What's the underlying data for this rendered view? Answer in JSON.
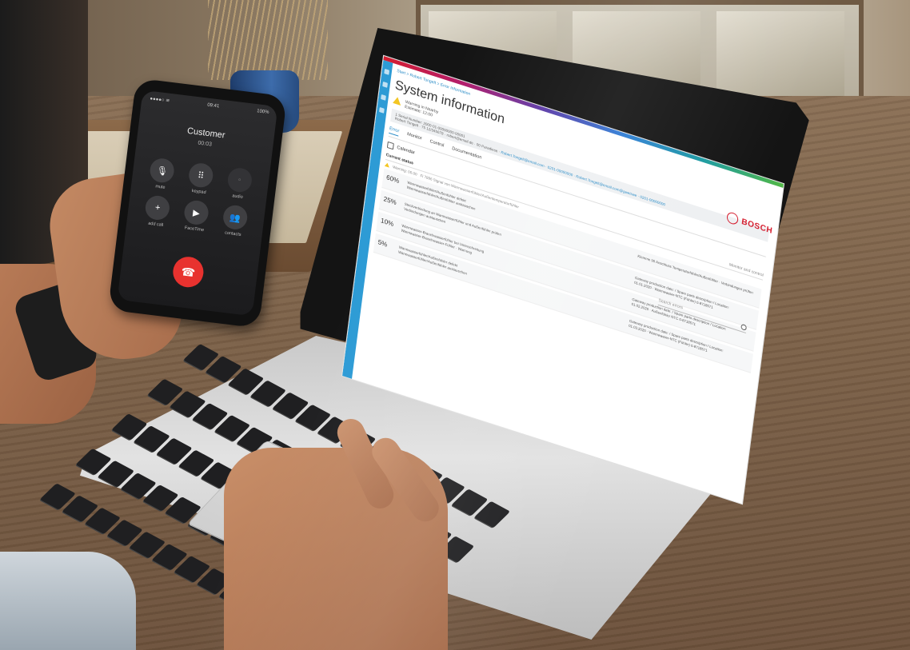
{
  "phone": {
    "status_left": "●●●●○ ≋",
    "status_time": "09:41",
    "status_right": "100%",
    "caller": "Customer",
    "call_timer": "00:03",
    "keys": [
      {
        "icon": "mute-icon",
        "glyph": "🎙",
        "label": "mute"
      },
      {
        "icon": "keypad-icon",
        "glyph": "⠿",
        "label": "keypad"
      },
      {
        "icon": "audio-icon",
        "glyph": "◦",
        "label": "audio"
      },
      {
        "icon": "add-call-icon",
        "glyph": "+",
        "label": "add call"
      },
      {
        "icon": "facetime-icon",
        "glyph": "▶",
        "label": "FaceTime"
      },
      {
        "icon": "contacts-icon",
        "glyph": "👥",
        "label": "contacts"
      }
    ],
    "end_call_glyph": "☎"
  },
  "screen": {
    "breadcrumb": "Start > Robert Tongelt > Error Information",
    "title": "System information",
    "warning": {
      "title": "Warning in Nearby",
      "subtitle": "Estimate: 12:00"
    },
    "info_line1": "1 Serial Number: 2000-01-00000000-00001",
    "info_line2": "Robert Tongelt · 75 12/345678 · robert@email.de · 00 Paradiese ·",
    "info_link": "Robert.Tongelt@email.com · 0201-00000000 · Robert.Tongelt@email.com@gweiswe · 0201-00000000",
    "tabs": [
      "Error",
      "Monitor",
      "Control",
      "Documentation"
    ],
    "active_tab": "Error",
    "calendar_label": "Calendar",
    "section_title": "Current status",
    "section_right": "Monitor and control",
    "warn_row": "Warning: 00.00",
    "warn_row_detail": "Fl 7896 Signal von Warmwasserfühler/Außentemperaturfühler",
    "search_placeholder": "Search errors",
    "causes": [
      {
        "pct": "60%",
        "cause": "Warmwasserfühler/Außenfühler defekt",
        "action": "Warmwasserfühler/Außenfühler austauschen",
        "detail_label": "",
        "detail": "Klemme 90 Anschluss Temperaturfühler/Außenfühler · Verbindungen prüfen"
      },
      {
        "pct": "25%",
        "cause": "Steckverbindung an Warmwasserfühler und Außenfühler prüfen",
        "action": "Verbindungen austauschen",
        "detail_label": "Gateway production date: / Spare parts description / Location:",
        "detail": "01.01.2020 · Warmwasser-NTC (Fühler) 0-8718571"
      },
      {
        "pct": "10%",
        "cause": "Warmwasser-Brauchwasserfühler bei Unterschreitung",
        "action": "Warmwasser-Brauchwasser-Fühler · Warnung",
        "detail_label": "Gateway production date: / Spare parts description / Location:",
        "detail": "01.02.2020 · Außenfühler NTC 0-8718571"
      },
      {
        "pct": "5%",
        "cause": "Warmwasserfühler/Außenfühler defekt",
        "action": "Warmwasserfühler/Außenfühler austauschen",
        "detail_label": "Gateway production date: / Spare parts description / Location:",
        "detail": "01.03.2020 · Warmwasser-NTC (Fühler) 0-8718571"
      }
    ],
    "brand": "BOSCH"
  }
}
